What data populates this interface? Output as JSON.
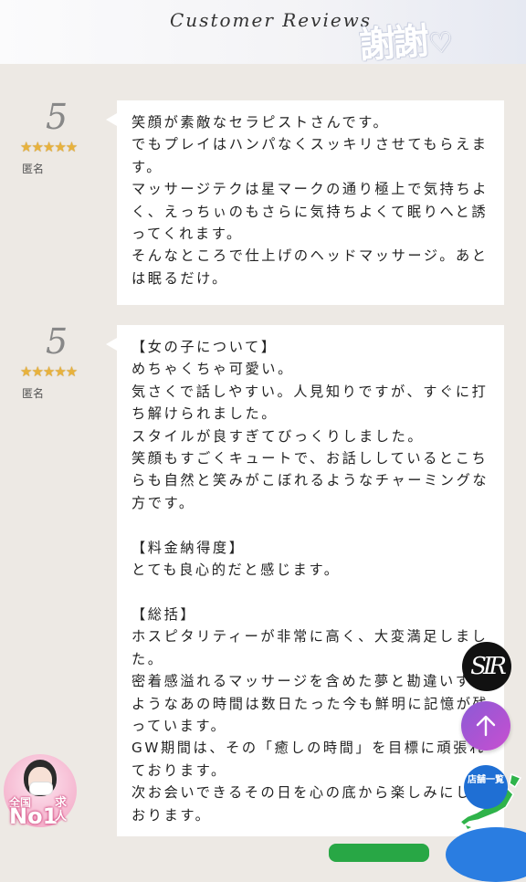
{
  "header": {
    "title": "Customer Reviews",
    "deco_text": "謝謝",
    "deco_heart": "♡"
  },
  "reviews": [
    {
      "rating": "5",
      "stars": "★★★★★",
      "author": "匿名",
      "text": "笑顔が素敵なセラピストさんです。\nでもプレイはハンパなくスッキリさせてもらえます。\nマッサージテクは星マークの通り極上で気持ちよく、えっちぃのもさらに気持ちよくて眠りへと誘ってくれます。\nそんなところで仕上げのヘッドマッサージ。あとは眠るだけ。"
    },
    {
      "rating": "5",
      "stars": "★★★★★",
      "author": "匿名",
      "text": "【女の子について】\nめちゃくちゃ可愛い。\n気さくで話しやすい。人見知りですが、すぐに打ち解けられました。\nスタイルが良すぎてびっくりしました。\n笑顔もすごくキュートで、お話ししているとこちらも自然と笑みがこぼれるようなチャーミングな方です。\n\n【料金納得度】\nとても良心的だと感じます。\n\n【総括】\nホスピタリティーが非常に高く、大変満足しました。\n密着感溢れるマッサージを含めた夢と勘違いするようなあの時間は数日たった今も鮮明に記憶が残っています。\nGW期間は、その「癒しの時間」を目標に頑張れております。\n次お会いできるその日を心の底から楽しみにしております。"
    }
  ],
  "floating": {
    "brand_logo": "SIR",
    "store_button": "店舗一覧",
    "recruit_a": "全国",
    "recruit_b": "No1",
    "recruit_c": "求人"
  },
  "colors": {
    "background": "#ede9e4",
    "card": "#ffffff",
    "star": "#e8b23c",
    "scroll_top": "#a256d4",
    "store_button": "#1f6fd4"
  },
  "icons": [
    "arrow-up-icon",
    "japan-map-icon"
  ]
}
